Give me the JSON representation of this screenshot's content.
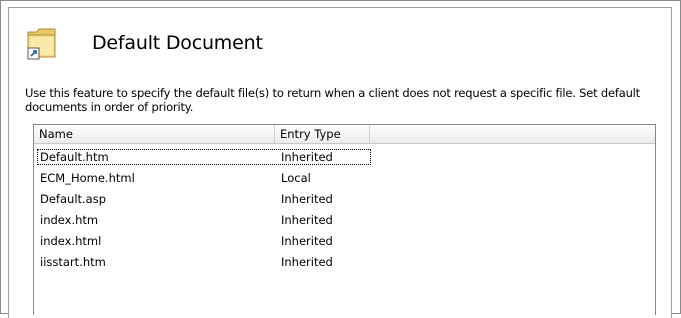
{
  "header": {
    "icon": "folder-document-icon",
    "title": "Default Document"
  },
  "description": "Use this feature to specify the default file(s) to return when a client does not request a specific file. Set default documents in order of priority.",
  "list": {
    "columns": [
      "Name",
      "Entry Type"
    ],
    "rows": [
      {
        "name": "Default.htm",
        "type": "Inherited"
      },
      {
        "name": "ECM_Home.html",
        "type": "Local"
      },
      {
        "name": "Default.asp",
        "type": "Inherited"
      },
      {
        "name": "index.htm",
        "type": "Inherited"
      },
      {
        "name": "index.html",
        "type": "Inherited"
      },
      {
        "name": "iisstart.htm",
        "type": "Inherited"
      }
    ]
  }
}
